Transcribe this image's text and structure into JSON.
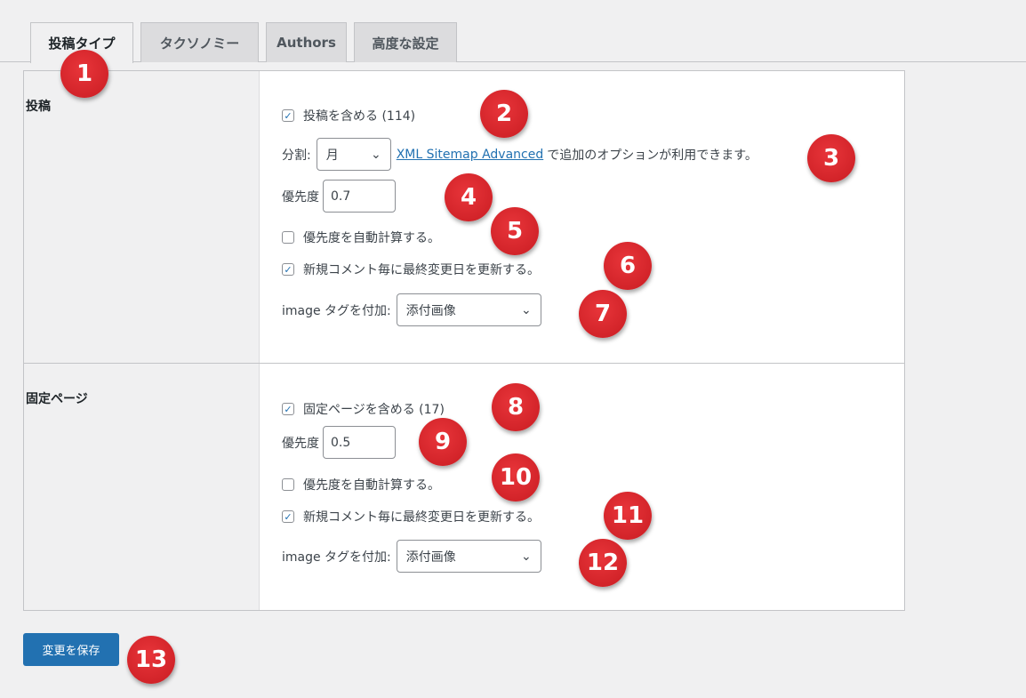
{
  "tabs": [
    {
      "label": "投稿タイプ",
      "active": true
    },
    {
      "label": "タクソノミー"
    },
    {
      "label": "Authors"
    },
    {
      "label": "高度な設定"
    }
  ],
  "posts": {
    "heading": "投稿",
    "include_label": "投稿を含める (114)",
    "include_checked": true,
    "split_label": "分割:",
    "split_value": "月",
    "link_text": "XML Sitemap Advanced",
    "link_suffix": "で追加のオプションが利用できます。",
    "priority_label": "優先度",
    "priority_value": "0.7",
    "auto_priority_label": "優先度を自動計算する。",
    "auto_priority_checked": false,
    "update_label": "新規コメント毎に最終変更日を更新する。",
    "update_checked": true,
    "image_label": "image タグを付加:",
    "image_value": "添付画像"
  },
  "pages": {
    "heading": "固定ページ",
    "include_label": "固定ページを含める (17)",
    "include_checked": true,
    "priority_label": "優先度",
    "priority_value": "0.5",
    "auto_priority_label": "優先度を自動計算する。",
    "auto_priority_checked": false,
    "update_label": "新規コメント毎に最終変更日を更新する。",
    "update_checked": true,
    "image_label": "image タグを付加:",
    "image_value": "添付画像"
  },
  "save_label": "変更を保存",
  "markers": [
    "1",
    "2",
    "3",
    "4",
    "5",
    "6",
    "7",
    "8",
    "9",
    "10",
    "11",
    "12",
    "13"
  ],
  "colors": {
    "accent": "#2271b1",
    "marker": "#d9262c"
  }
}
